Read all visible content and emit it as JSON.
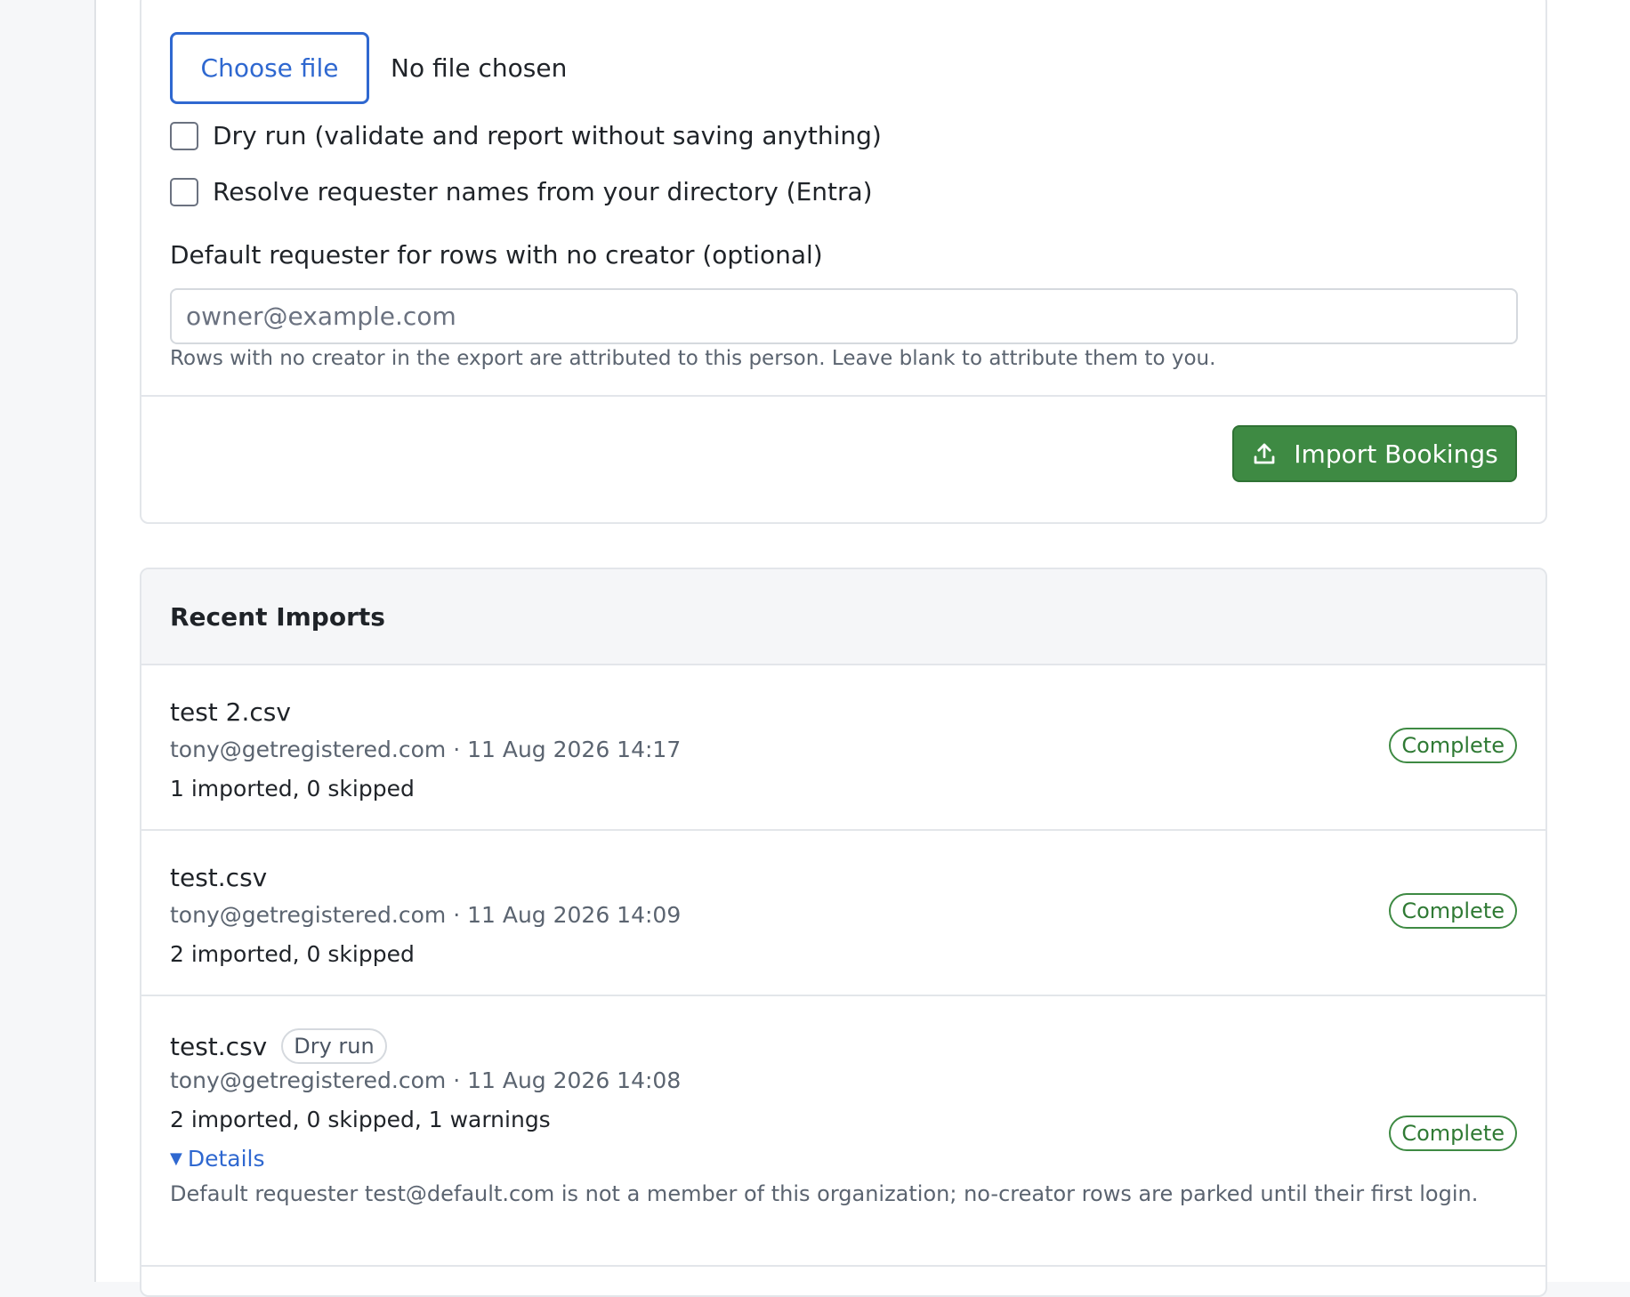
{
  "upload": {
    "choose_file_label": "Choose file",
    "file_status": "No file chosen",
    "dry_run_label": "Dry run (validate and report without saving anything)",
    "resolve_names_label": "Resolve requester names from your directory (Entra)",
    "default_requester_label": "Default requester for rows with no creator (optional)",
    "default_requester_placeholder": "owner@example.com",
    "default_requester_value": "",
    "help_text": "Rows with no creator in the export are attributed to this person. Leave blank to attribute them to you.",
    "import_button_label": "Import Bookings"
  },
  "recent": {
    "title": "Recent Imports",
    "items": [
      {
        "name": "test 2.csv",
        "meta": "tony@getregistered.com · 11 Aug 2026 14:17",
        "stats": "1 imported, 0 skipped",
        "status": "Complete"
      },
      {
        "name": "test.csv",
        "meta": "tony@getregistered.com · 11 Aug 2026 14:09",
        "stats": "2 imported, 0 skipped",
        "status": "Complete"
      },
      {
        "name": "test.csv",
        "badge": "Dry run",
        "meta": "tony@getregistered.com · 11 Aug 2026 14:08",
        "stats": "2 imported, 0 skipped, 1 warnings",
        "status": "Complete",
        "details_label": "Details",
        "details_text": "Default requester test@default.com is not a member of this organization; no-creator rows are parked until their first login."
      }
    ]
  },
  "colors": {
    "accent_blue": "#2f68d0",
    "success_green": "#3e8a43",
    "muted_text": "#5b6470"
  }
}
